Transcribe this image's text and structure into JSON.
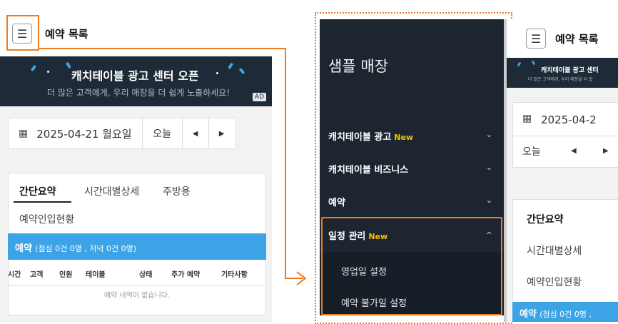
{
  "left": {
    "menu_icon": "hamburger-menu-icon",
    "title": "예약 목록",
    "banner": {
      "headline": "캐치테이블 광고 센터 오픈",
      "sub": "더 많은 고객에게, 우리 매장을 더 쉽게 노출하세요!",
      "ad": "AD"
    },
    "date": "2025-04-21 월요일",
    "today": "오늘",
    "prev": "◀",
    "next": "▶",
    "tabs": [
      "간단요약",
      "시간대별상세",
      "주방용",
      "예약인입현황"
    ],
    "summary_label": "예약",
    "summary_detail": "(점심 0건 0명 , 저녁 0건 0명)",
    "columns": [
      "시간",
      "고객",
      "인원",
      "테이블",
      "상태",
      "추가 예약",
      "기타사항"
    ],
    "empty_text": "예약 내역이 없습니다."
  },
  "sidebar": {
    "store_name": "샘플 매장",
    "items": [
      {
        "label": "캐치테이블 광고",
        "badge": "New",
        "chevron": "⌄"
      },
      {
        "label": "캐치테이블 비즈니스",
        "badge": "",
        "chevron": "⌄"
      },
      {
        "label": "예약",
        "badge": "",
        "chevron": "⌄"
      },
      {
        "label": "일정 관리",
        "badge": "New",
        "chevron": "^"
      }
    ],
    "sub_items": [
      "영업일 설정",
      "예약 불가일 설정"
    ]
  },
  "right": {
    "menu_icon": "hamburger-menu-icon",
    "title": "예약 목록",
    "banner_headline": "캐치테이블 광고 센터",
    "banner_sub": "더 많은 고객에게, 우리 매장을 더 쉽",
    "date": "2025-04-2",
    "today": "오늘",
    "prev": "◀",
    "next": "▶",
    "tabs": [
      "간단요약",
      "시간대별상세",
      "예약인입현황"
    ],
    "summary_label": "예약",
    "summary_detail": "(점심 0건 0명 ,"
  },
  "colors": {
    "highlight": "#f07a1f",
    "banner_bg": "#1e2a38",
    "sidebar_bg": "#1c2530",
    "new_badge": "#f6c100",
    "summary_blue": "#3ba3e6"
  }
}
